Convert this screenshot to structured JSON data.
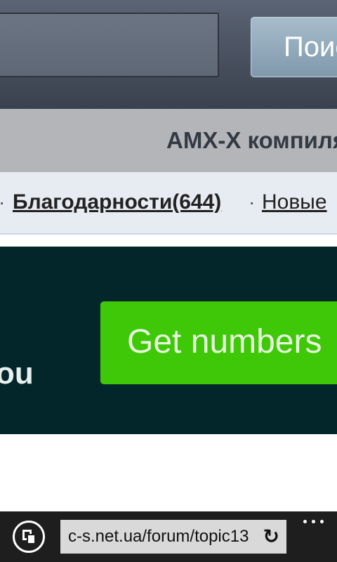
{
  "header": {
    "search_placeholder": "",
    "search_button_label": "Поиск"
  },
  "topic": {
    "title": "AMX-X компиляторы"
  },
  "links": {
    "thanks": "Благодарности(644)",
    "new": "Новые",
    "separator": "·"
  },
  "ad": {
    "side_text": "ou",
    "cta_label": "Get numbers"
  },
  "browser": {
    "url": "c-s.net.ua/forum/topic13",
    "refresh_icon": "refresh-icon",
    "tabs_icon": "tabs-icon",
    "more_icon": "more-icon"
  }
}
